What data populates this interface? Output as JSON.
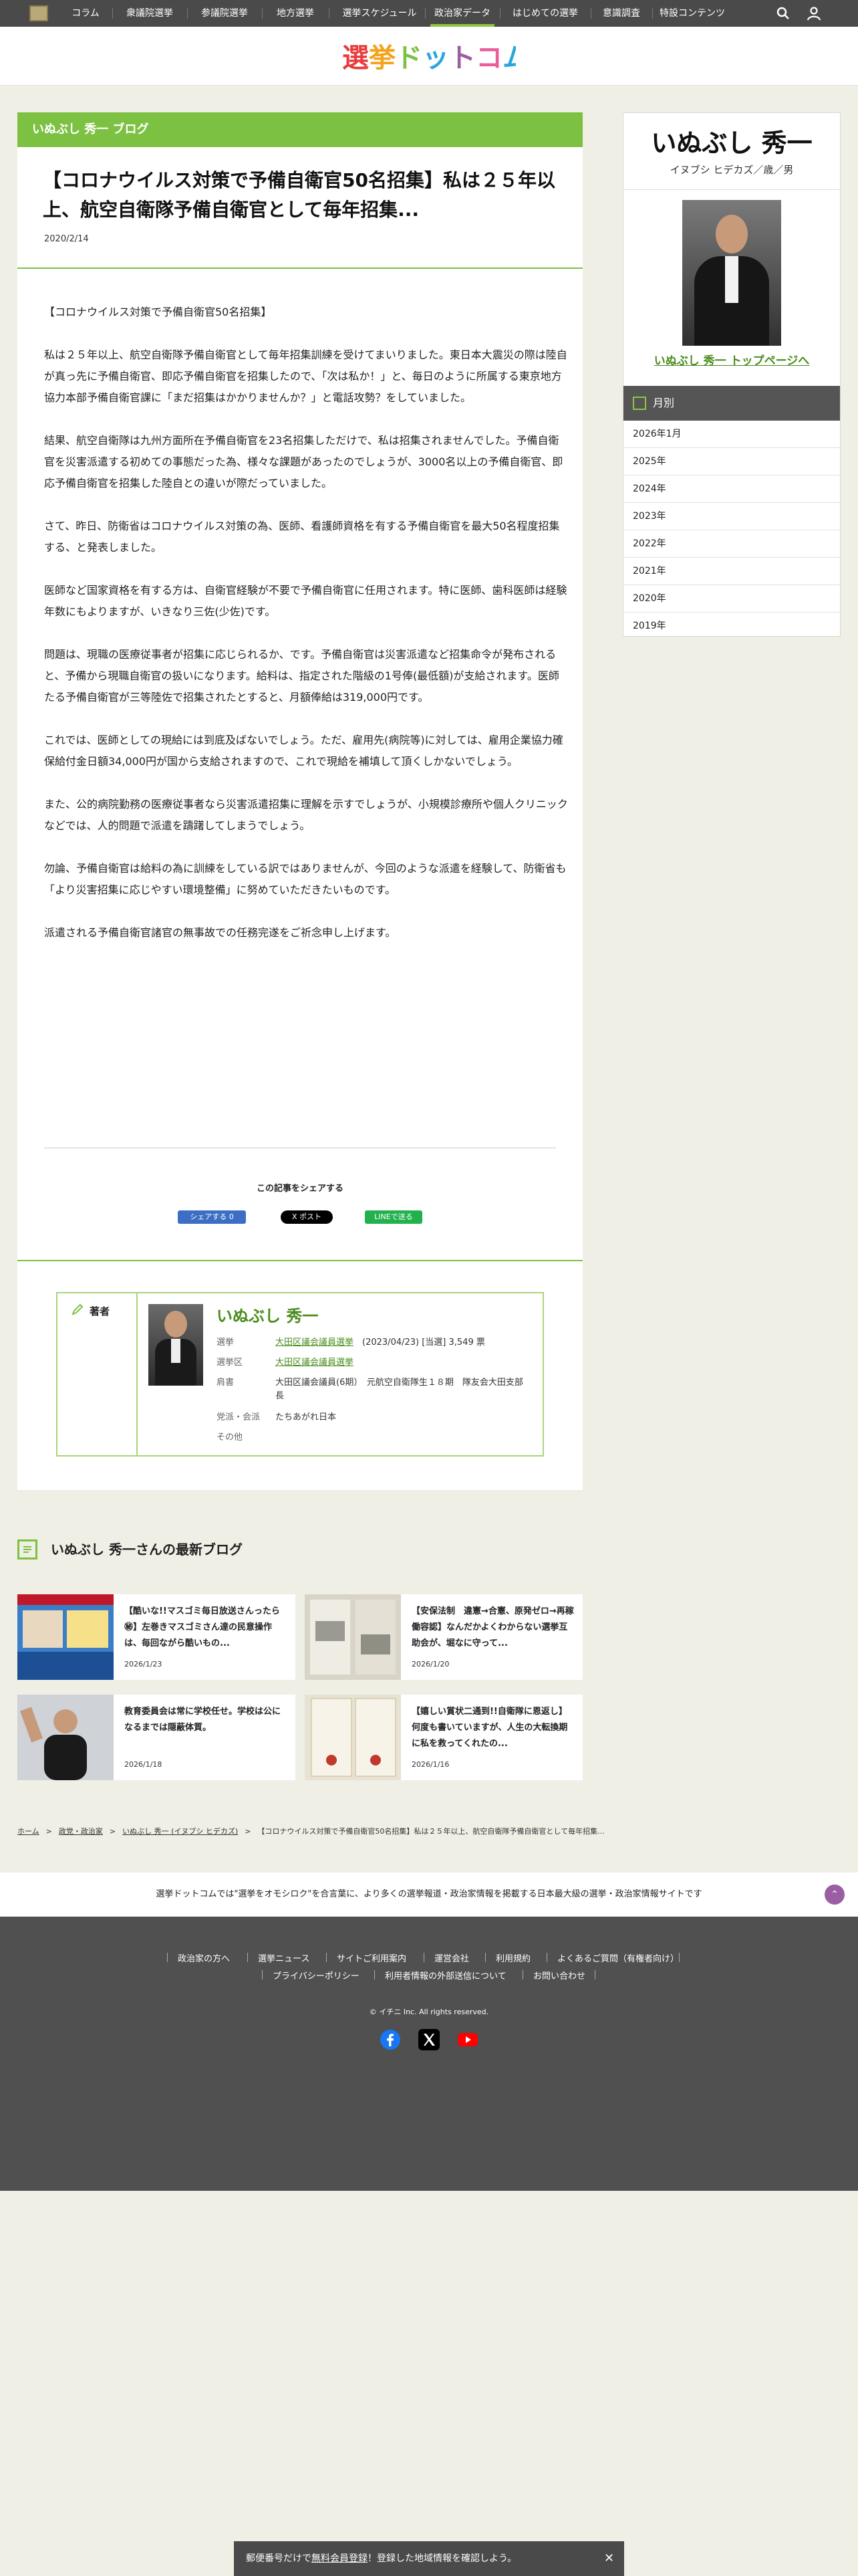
{
  "nav": {
    "items": [
      "コラム",
      "衆議院選挙",
      "参議院選挙",
      "地方選挙",
      "選挙スケジュール",
      "政治家データ",
      "はじめての選挙",
      "意識調査",
      "特設コンテンツ"
    ],
    "active_index": 5,
    "icons": [
      "search-icon",
      "user-icon"
    ]
  },
  "brand": {
    "logo_text": "選挙ドットコム",
    "colors": [
      "#e83c3c",
      "#f4a31c",
      "#7dc143",
      "#2aa6de",
      "#9c5ea3",
      "#e85d9a"
    ]
  },
  "article": {
    "blog_label": "いぬぶし 秀一 ブログ",
    "title": "【コロナウイルス対策で予備自衛官50名招集】私は２５年以上、航空自衛隊予備自衛官として毎年招集...",
    "date": "2020/2/14",
    "paragraphs": [
      "【コロナウイルス対策で予備自衛官50名招集】",
      "私は２５年以上、航空自衛隊予備自衛官として毎年招集訓練を受けてまいりました。東日本大震災の際は陸自が真っ先に予備自衛官、即応予備自衛官を招集したので、「次は私か！」と、毎日のように所属する東京地方協力本部予備自衛官課に「まだ招集はかかりませんか？」と電話攻勢？をしていました。",
      "結果、航空自衛隊は九州方面所在予備自衛官を23名招集しただけで、私は招集されませんでした。予備自衛官を災害派遣する初めての事態だった為、様々な課題があったのでしょうが、3000名以上の予備自衛官、即応予備自衛官を招集した陸自との違いが際だっていました。",
      "さて、昨日、防衛省はコロナウイルス対策の為、医師、看護師資格を有する予備自衛官を最大50名程度招集する、と発表しました。",
      "医師など国家資格を有する方は、自衛官経験が不要で予備自衛官に任用されます。特に医師、歯科医師は経験年数にもよりますが、いきなり三佐(少佐)です。",
      "問題は、現職の医療従事者が招集に応じられるか、です。予備自衛官は災害派遣など招集命令が発布されると、予備から現職自衛官の扱いになります。給料は、指定された階級の1号俸(最低額)が支給されます。医師たる予備自衛官が三等陸佐で招集されたとすると、月額俸給は319,000円です。",
      "これでは、医師としての現給には到底及ばないでしょう。ただ、雇用先(病院等)に対しては、雇用企業協力確保給付金日額34,000円が国から支給されますので、これで現給を補填して頂くしかないでしょう。",
      "また、公的病院勤務の医療従事者なら災害派遣招集に理解を示すでしょうが、小規模診療所や個人クリニックなどでは、人的問題で派遣を躊躇してしまうでしょう。",
      "勿論、予備自衛官は給料の為に訓練をしている訳ではありませんが、今回のような派遣を経験して、防衛省も「より災害招集に応じやすい環境整備」に努めていただきたいものです。",
      "派遣される予備自衛官諸官の無事故での任務完遂をご祈念申し上げます。"
    ],
    "share_title": "この記事をシェアする",
    "share_buttons": [
      {
        "label": "シェアする 0",
        "color": "#3b6ec4"
      },
      {
        "label": "X ポスト",
        "color": "#000000"
      },
      {
        "label": "LINEで送る",
        "color": "#22b14c"
      }
    ]
  },
  "author": {
    "label": "著者",
    "name": "いぬぶし 秀一",
    "rows": [
      {
        "key": "選挙",
        "link": "大田区議会議員選挙",
        "text": "(2023/04/23) [当選] 3,549 票"
      },
      {
        "key": "選挙区",
        "link": "大田区議会議員選挙",
        "text": ""
      },
      {
        "key": "肩書",
        "link": "",
        "text": "大田区議会議員(6期）　元航空自衛隊生１８期　隊友会大田支部長"
      },
      {
        "key": "党派・会派",
        "link": "",
        "text": "たちあがれ日本"
      },
      {
        "key": "その他",
        "link": "",
        "text": ""
      }
    ]
  },
  "sidebar": {
    "name": "いぬぶし 秀一",
    "kana": "イヌブシ ヒデカズ／歳／男",
    "top_link": "いぬぶし 秀一 トップページへ",
    "month_head": "月別",
    "months": [
      "2026年1月",
      "2025年",
      "2024年",
      "2023年",
      "2022年",
      "2021年",
      "2020年",
      "2019年"
    ]
  },
  "latest": {
    "title": "いぬぶし 秀一さんの最新ブログ",
    "cards": [
      {
        "title": "【酷いな!!マスゴミ毎日放送さんったら㊙】左巻きマスゴミさん達の民意操作は、毎回ながら酷いもの...",
        "date": "2026/1/23"
      },
      {
        "title": "【安保法制　違憲→合憲、原発ゼロ→再稼働容認】なんだかよくわからない選挙互助会が、堀なに守って...",
        "date": "2026/1/20"
      },
      {
        "title": "教育委員会は常に学校任せ。学校は公になるまでは隠蔽体質。",
        "date": "2026/1/18"
      },
      {
        "title": "【嬉しい賞状二通到!!自衛隊に恩返し】何度も書いていますが、人生の大転換期に私を救ってくれたの...",
        "date": "2026/1/16"
      }
    ]
  },
  "breadcrumb": [
    "ホーム",
    "政党・政治家",
    "いぬぶし 秀一 (イヌブシ ヒデカズ)",
    "【コロナウイルス対策で予備自衛官50名招集】私は２５年以上、航空自衛隊予備自衛官として毎年招集..."
  ],
  "footer": {
    "tagline": "選挙ドットコムでは\"選挙をオモシロク\"を合言葉に、より多くの選挙報道・政治家情報を掲載する日本最大級の選挙・政治家情報サイトです",
    "links_row1": [
      "政治家の方へ",
      "選挙ニュース",
      "サイトご利用案内",
      "運営会社",
      "利用規約",
      "よくあるご質問（有権者向け）"
    ],
    "links_row2": [
      "プライバシーポリシー",
      "利用者情報の外部送信について",
      "お問い合わせ"
    ],
    "copyright": "© イチニ Inc. All rights reserved.",
    "social": [
      "facebook-icon",
      "x-icon",
      "youtube-icon"
    ]
  },
  "banner": {
    "prefix": "郵便番号だけで",
    "link": "無料会員登録",
    "suffix": "！登録した地域情報を確認しよう。",
    "close": "✕"
  }
}
